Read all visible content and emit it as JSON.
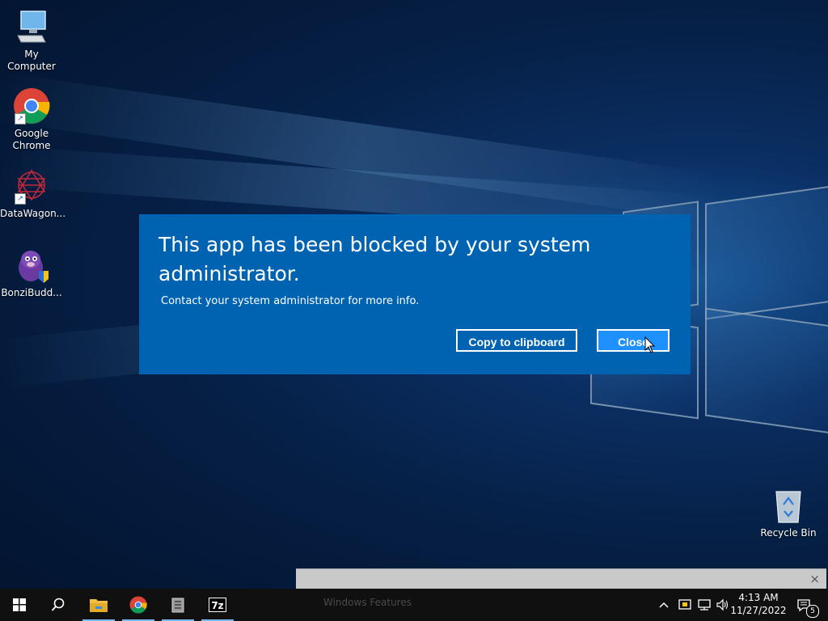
{
  "desktop": {
    "icons": [
      {
        "label": "My Computer"
      },
      {
        "label": "Google Chrome"
      },
      {
        "label": "DataWagon..."
      },
      {
        "label": "BonziBudd..."
      },
      {
        "label": "Recycle Bin"
      }
    ]
  },
  "dialog": {
    "title": "This app has been blocked by your system administrator.",
    "message": "Contact your system administrator for more info.",
    "copy_button": "Copy to clipboard",
    "close_button": "Close",
    "background": "#0063b1",
    "accent": "#1e90ff"
  },
  "notification": {
    "text": "Windows Features",
    "close": "×"
  },
  "taskbar": {
    "apps": [
      "start",
      "search",
      "file-explorer",
      "google-chrome",
      "archive-manager",
      "7-zip"
    ],
    "clock": {
      "time": "4:13 AM",
      "date": "11/27/2022"
    },
    "notification_count": "5"
  }
}
